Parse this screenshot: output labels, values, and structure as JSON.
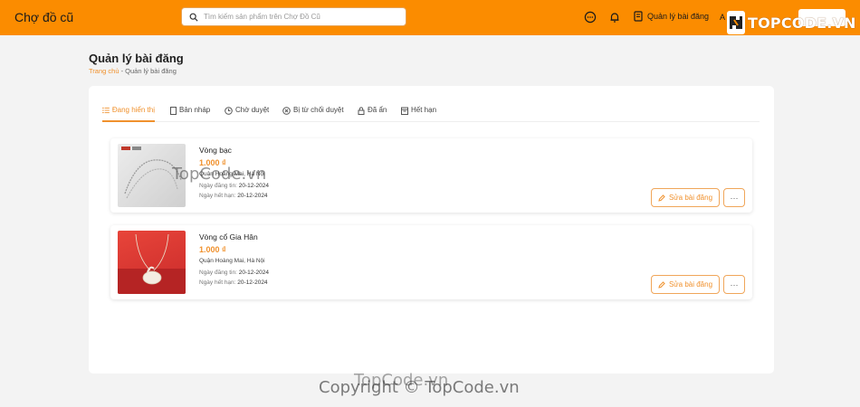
{
  "header": {
    "brand": "Chợ đồ cũ",
    "search_placeholder": "Tìm kiếm sản phẩm trên Chợ Đồ Cũ",
    "manage_label": "Quản lý bài đăng",
    "account_initial": "A",
    "logo_text": "TOPCODE.VN",
    "accent_color": "#fb8c00"
  },
  "page": {
    "title": "Quản lý bài đăng",
    "breadcrumb_home": "Trang chủ",
    "breadcrumb_sep": " - ",
    "breadcrumb_current": "Quản lý bài đăng"
  },
  "tabs": [
    {
      "label": "Đang hiển thị",
      "icon": "list-icon",
      "active": true
    },
    {
      "label": "Bản nháp",
      "icon": "file-icon",
      "active": false
    },
    {
      "label": "Chờ duyệt",
      "icon": "clock-icon",
      "active": false
    },
    {
      "label": "Bị từ chối duyệt",
      "icon": "close-circle-icon",
      "active": false
    },
    {
      "label": "Đã ẩn",
      "icon": "lock-icon",
      "active": false
    },
    {
      "label": "Hết hạn",
      "icon": "calendar-icon",
      "active": false
    }
  ],
  "listings": [
    {
      "title": "Vòng bạc",
      "price": "1.000 ₫",
      "location": "Quận Hoàng Mai, Hà Nội",
      "posted_label": "Ngày đăng tin:",
      "posted_date": "20-12-2024",
      "expires_label": "Ngày hết hạn:",
      "expires_date": "20-12-2024",
      "edit_label": "Sửa bài đăng",
      "more_label": "···",
      "image": "silver-chain-image"
    },
    {
      "title": "Vòng cổ Gia Hân",
      "price": "1.000 ₫",
      "location": "Quận Hoàng Mai, Hà Nội",
      "posted_label": "Ngày đăng tin:",
      "posted_date": "20-12-2024",
      "expires_label": "Ngày hết hạn:",
      "expires_date": "20-12-2024",
      "edit_label": "Sửa bài đăng",
      "more_label": "···",
      "image": "swan-necklace-image"
    }
  ],
  "watermarks": {
    "inline": "TopCode.vn",
    "footer_top": "TopCode.vn",
    "footer_copy": "Copyright © TopCode.vn"
  }
}
